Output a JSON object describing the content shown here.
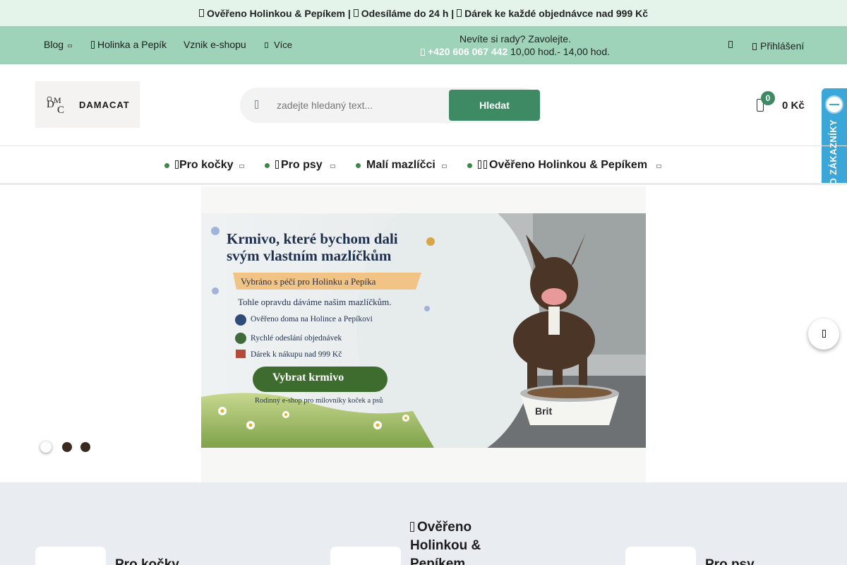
{
  "announcement": {
    "part1": "Ověřeno Holinkou & Pepíkem |",
    "part2": "Odesíláme do 24 h |",
    "part3": "Dárek ke každé objednávce nad 999 Kč"
  },
  "top_nav": {
    "items": [
      "Blog",
      "Holinka a Pepík",
      "Vznik e-shopu",
      "Více"
    ],
    "contact_text": "Nevíte si rady? Zavolejte.",
    "phone": "+420 606 067 442",
    "hours": "10,00 hod.- 14,00 hod.",
    "login_label": "Přihlášení"
  },
  "logo": {
    "text": "DAMACAT"
  },
  "search": {
    "placeholder": "zadejte hledaný text...",
    "button_label": "Hledat"
  },
  "cart": {
    "count": "0",
    "total": "0 Kč"
  },
  "trust_badge": {
    "label": "OVĚŘENO ZÁKAZNÍKY"
  },
  "category_nav": {
    "items": [
      "Pro kočky",
      "Pro psy",
      "Malí mazlíčci",
      "Ověřeno Holinkou & Pepíkem"
    ]
  },
  "banner": {
    "headline_line1": "Krmivo, které bychom dali",
    "headline_line2": "svým vlastním mazlíčkům",
    "ribbon": "Vybráno s péčí pro Holinku a Pepíka",
    "subtitle": "Tohle opravdu dáváme našim mazlíčkům.",
    "bullets": [
      "Ověřeno doma na Holince a Pepíkovi",
      "Rychlé odeslání objednávek",
      "Dárek k nákupu nad 999 Kč"
    ],
    "cta": "Vybrat krmivo",
    "footer": "Rodinný e-shop pro milovníky koček a psů",
    "bowl_brand": "Brit"
  },
  "slider": {
    "slide_count": 3,
    "active_index": 0
  },
  "category_tiles": {
    "left": "Pro kočky",
    "middle": "Ověřeno Holinkou & Pepíkem",
    "right": "Pro psy"
  },
  "colors": {
    "announce_bg": "#e4f4ea",
    "topnav_bg": "#9ed3b9",
    "brand_green": "#3e8a64",
    "trust_blue": "#3aa7d8",
    "categories_bg": "#e9edf1"
  },
  "icons": [
    "check-icon",
    "truck-icon",
    "gift-icon",
    "phone-icon",
    "user-icon",
    "lock-icon",
    "search-icon",
    "cart-icon",
    "paw-icon",
    "chevron-right-icon"
  ]
}
